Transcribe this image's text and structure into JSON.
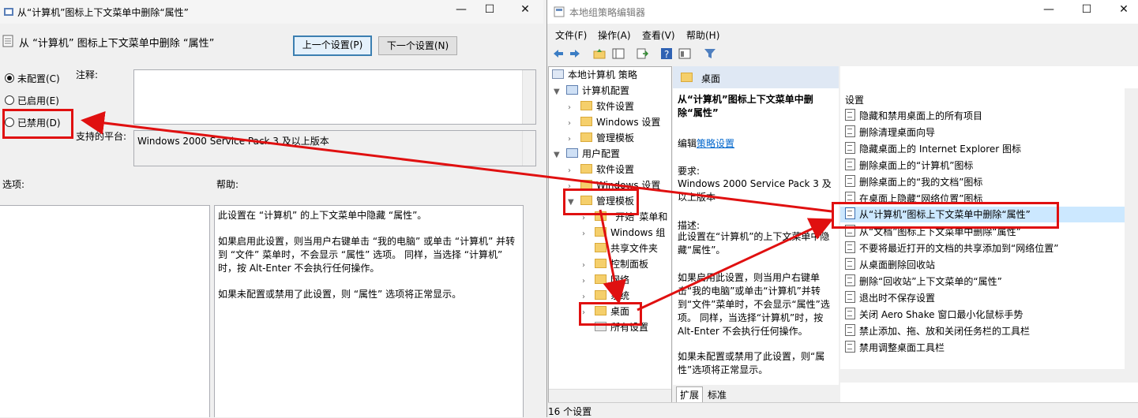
{
  "dialog": {
    "title": "从“计算机”图标上下文菜单中删除“属性”",
    "setting_name": "从 “计算机” 图标上下文菜单中删除 “属性”",
    "prev_button": "上一个设置(P)",
    "next_button": "下一个设置(N)",
    "radio_not_configured": "未配置(C)",
    "radio_enabled": "已启用(E)",
    "radio_disabled": "已禁用(D)",
    "comment_label": "注释:",
    "platform_label": "支持的平台:",
    "platform_value": "Windows 2000 Service Pack 3 及以上版本",
    "options_label": "选项:",
    "help_label": "帮助:",
    "help_lines": [
      "此设置在 “计算机” 的上下文菜单中隐藏 “属性”。",
      "如果启用此设置，则当用户右键单击 “我的电脑” 或单击 “计算机” 并转到 “文件” 菜单时，不会显示 “属性” 选项。 同样，当选择 “计算机” 时，按 Alt-Enter 不会执行任何操作。",
      "如果未配置或禁用了此设置，则 “属性” 选项将正常显示。"
    ]
  },
  "editor": {
    "title": "本地组策略编辑器",
    "menu": [
      "文件(F)",
      "操作(A)",
      "查看(V)",
      "帮助(H)"
    ],
    "tree": [
      "本地计算机 策略",
      "计算机配置",
      "软件设置",
      "Windows 设置",
      "管理模板",
      "用户配置",
      "软件设置",
      "Windows 设置",
      "管理模板",
      "“开始”菜单和",
      "Windows 组",
      "共享文件夹",
      "控制面板",
      "网络",
      "系统",
      "桌面",
      "所有设置"
    ],
    "header_folder": "桌面",
    "detail": {
      "title": "从“计算机”图标上下文菜单中删除“属性”",
      "edit_prefix": "编辑",
      "edit_link": "策略设置",
      "req_label": "要求:",
      "req_value": "Windows 2000 Service Pack 3 及以上版本",
      "desc_label": "描述:",
      "desc_1": "此设置在“计算机”的上下文菜单中隐藏“属性”。",
      "desc_2": "如果启用此设置，则当用户右键单击“我的电脑”或单击“计算机”并转到“文件”菜单时，不会显示“属性”选项。 同样，当选择“计算机”时，按 Alt-Enter 不会执行任何操作。",
      "desc_3": "如果未配置或禁用了此设置，则“属性”选项将正常显示。"
    },
    "list_header": "设置",
    "list": [
      "隐藏和禁用桌面上的所有项目",
      "删除清理桌面向导",
      "隐藏桌面上的 Internet Explorer 图标",
      "删除桌面上的“计算机”图标",
      "删除桌面上的“我的文档”图标",
      "在桌面上隐藏“网络位置”图标",
      "从“计算机”图标上下文菜单中删除“属性”",
      "从“文档”图标上下文菜单中删除“属性”",
      "不要将最近打开的文档的共享添加到“网络位置”",
      "从桌面删除回收站",
      "删除“回收站”上下文菜单的“属性”",
      "退出时不保存设置",
      "关闭 Aero Shake 窗口最小化鼠标手势",
      "禁止添加、拖、放和关闭任务栏的工具栏",
      "禁用调整桌面工具栏"
    ],
    "tabs": [
      "扩展",
      "标准"
    ],
    "status": "16 个设置"
  },
  "colors": {
    "highlight": "#e01010",
    "selection": "#cce8ff",
    "link": "#0066cc"
  }
}
